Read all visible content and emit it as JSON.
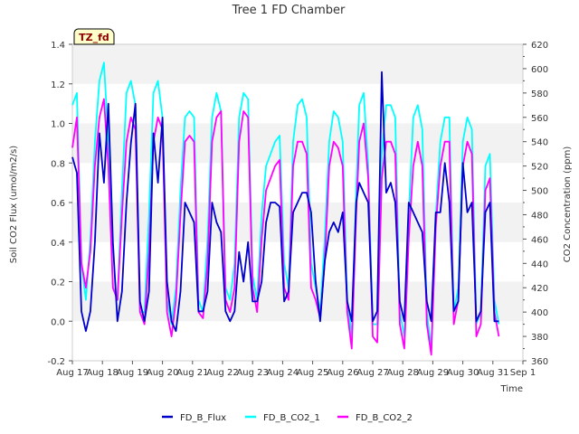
{
  "chart_data": {
    "type": "line",
    "title": "Tree 1 FD Chamber",
    "xlabel": "Time",
    "ylabel": "Soil CO2 Flux (umol/m2/s)",
    "y2label": "CO2 Concentration (ppm)",
    "badge": "TZ_fd",
    "grid": "horizontal bands",
    "legend_position": "bottom-center",
    "xlim": [
      17,
      32
    ],
    "ylim": [
      -0.2,
      1.4
    ],
    "y2lim": [
      360,
      620
    ],
    "x_ticks": [
      {
        "x": 17,
        "label": "Aug 17"
      },
      {
        "x": 18,
        "label": "Aug 18"
      },
      {
        "x": 19,
        "label": "Aug 19"
      },
      {
        "x": 20,
        "label": "Aug 20"
      },
      {
        "x": 21,
        "label": "Aug 21"
      },
      {
        "x": 22,
        "label": "Aug 22"
      },
      {
        "x": 23,
        "label": "Aug 23"
      },
      {
        "x": 24,
        "label": "Aug 24"
      },
      {
        "x": 25,
        "label": "Aug 25"
      },
      {
        "x": 26,
        "label": "Aug 26"
      },
      {
        "x": 27,
        "label": "Aug 27"
      },
      {
        "x": 28,
        "label": "Aug 28"
      },
      {
        "x": 29,
        "label": "Aug 29"
      },
      {
        "x": 30,
        "label": "Aug 30"
      },
      {
        "x": 31,
        "label": "Aug 31"
      },
      {
        "x": 32,
        "label": "Sep 1"
      }
    ],
    "y_ticks": [
      "-0.2",
      "0.0",
      "0.2",
      "0.4",
      "0.6",
      "0.8",
      "1.0",
      "1.2",
      "1.4"
    ],
    "y2_ticks": [
      "360",
      "380",
      "400",
      "420",
      "440",
      "460",
      "480",
      "500",
      "520",
      "540",
      "560",
      "580",
      "600",
      "620"
    ],
    "series": [
      {
        "name": "FD_B_Flux",
        "axis": "left",
        "color": "#0000cc",
        "x": [
          17.0,
          17.15,
          17.3,
          17.45,
          17.6,
          17.75,
          17.9,
          18.05,
          18.2,
          18.35,
          18.5,
          18.65,
          18.8,
          18.95,
          19.1,
          19.25,
          19.4,
          19.55,
          19.7,
          19.85,
          20.0,
          20.15,
          20.3,
          20.45,
          20.6,
          20.75,
          20.9,
          21.05,
          21.2,
          21.35,
          21.5,
          21.65,
          21.8,
          21.95,
          22.1,
          22.25,
          22.4,
          22.55,
          22.7,
          22.85,
          23.0,
          23.15,
          23.3,
          23.45,
          23.6,
          23.75,
          23.9,
          24.05,
          24.2,
          24.35,
          24.5,
          24.65,
          24.8,
          24.95,
          25.1,
          25.25,
          25.4,
          25.55,
          25.7,
          25.85,
          26.0,
          26.15,
          26.3,
          26.45,
          26.55,
          26.7,
          26.85,
          27.0,
          27.15,
          27.3,
          27.45,
          27.6,
          27.75,
          27.9,
          28.05,
          28.2,
          28.35,
          28.5,
          28.65,
          28.8,
          28.95,
          29.1,
          29.25,
          29.4,
          29.55,
          29.7,
          29.85,
          30.0,
          30.15,
          30.3,
          30.45,
          30.6,
          30.75,
          30.9,
          31.05,
          31.2
        ],
        "y": [
          0.83,
          0.75,
          0.05,
          -0.05,
          0.05,
          0.4,
          0.95,
          0.7,
          1.1,
          0.4,
          0.0,
          0.15,
          0.6,
          0.9,
          1.1,
          0.1,
          0.0,
          0.15,
          0.95,
          0.7,
          1.03,
          0.2,
          0.0,
          -0.05,
          0.15,
          0.6,
          0.55,
          0.5,
          0.05,
          0.05,
          0.15,
          0.6,
          0.5,
          0.45,
          0.05,
          0.0,
          0.05,
          0.35,
          0.2,
          0.4,
          0.1,
          0.1,
          0.2,
          0.5,
          0.6,
          0.6,
          0.58,
          0.1,
          0.15,
          0.55,
          0.6,
          0.65,
          0.65,
          0.55,
          0.2,
          0.0,
          0.3,
          0.45,
          0.5,
          0.45,
          0.55,
          0.1,
          0.0,
          0.6,
          0.7,
          0.65,
          0.6,
          0.0,
          0.05,
          1.26,
          0.65,
          0.7,
          0.6,
          0.1,
          0.0,
          0.6,
          0.55,
          0.5,
          0.45,
          0.1,
          0.0,
          0.55,
          0.55,
          0.8,
          0.6,
          0.05,
          0.1,
          0.8,
          0.55,
          0.6,
          0.0,
          0.05,
          0.55,
          0.6,
          0.0,
          0.0
        ]
      },
      {
        "name": "FD_B_CO2_1",
        "axis": "right",
        "color": "#00ffff",
        "x": [
          17.0,
          17.15,
          17.3,
          17.45,
          17.6,
          17.75,
          17.9,
          18.05,
          18.2,
          18.35,
          18.5,
          18.65,
          18.8,
          18.95,
          19.1,
          19.25,
          19.4,
          19.55,
          19.7,
          19.85,
          20.0,
          20.15,
          20.3,
          20.45,
          20.6,
          20.75,
          20.9,
          21.05,
          21.2,
          21.35,
          21.5,
          21.65,
          21.8,
          21.95,
          22.1,
          22.25,
          22.4,
          22.55,
          22.7,
          22.85,
          23.0,
          23.15,
          23.3,
          23.45,
          23.6,
          23.75,
          23.9,
          24.05,
          24.2,
          24.35,
          24.5,
          24.65,
          24.8,
          24.95,
          25.1,
          25.25,
          25.4,
          25.55,
          25.7,
          25.85,
          26.0,
          26.15,
          26.3,
          26.45,
          26.55,
          26.7,
          26.85,
          27.0,
          27.15,
          27.3,
          27.45,
          27.6,
          27.75,
          27.9,
          28.05,
          28.2,
          28.35,
          28.5,
          28.65,
          28.8,
          28.95,
          29.1,
          29.25,
          29.4,
          29.55,
          29.7,
          29.85,
          30.0,
          30.15,
          30.3,
          30.45,
          30.6,
          30.75,
          30.9,
          31.05,
          31.2
        ],
        "y": [
          570,
          580,
          440,
          410,
          460,
          540,
          590,
          605,
          540,
          420,
          410,
          500,
          580,
          590,
          570,
          400,
          400,
          480,
          580,
          590,
          560,
          410,
          390,
          420,
          500,
          560,
          565,
          560,
          410,
          400,
          460,
          560,
          580,
          565,
          420,
          410,
          440,
          560,
          580,
          575,
          430,
          410,
          480,
          520,
          530,
          540,
          545,
          440,
          420,
          540,
          570,
          575,
          560,
          440,
          420,
          400,
          460,
          540,
          565,
          560,
          540,
          410,
          380,
          500,
          570,
          580,
          520,
          390,
          390,
          530,
          570,
          570,
          560,
          400,
          380,
          480,
          560,
          570,
          550,
          400,
          370,
          480,
          540,
          560,
          560,
          400,
          420,
          540,
          560,
          550,
          390,
          400,
          520,
          530,
          410,
          390
        ]
      },
      {
        "name": "FD_B_CO2_2",
        "axis": "right",
        "color": "#ff00ff",
        "x": [
          17.0,
          17.15,
          17.3,
          17.45,
          17.6,
          17.75,
          17.9,
          18.05,
          18.2,
          18.35,
          18.5,
          18.65,
          18.8,
          18.95,
          19.1,
          19.25,
          19.4,
          19.55,
          19.7,
          19.85,
          20.0,
          20.15,
          20.3,
          20.45,
          20.6,
          20.75,
          20.9,
          21.05,
          21.2,
          21.35,
          21.5,
          21.65,
          21.8,
          21.95,
          22.1,
          22.25,
          22.4,
          22.55,
          22.7,
          22.85,
          23.0,
          23.15,
          23.3,
          23.45,
          23.6,
          23.75,
          23.9,
          24.05,
          24.2,
          24.35,
          24.5,
          24.65,
          24.8,
          24.95,
          25.1,
          25.25,
          25.4,
          25.55,
          25.7,
          25.85,
          26.0,
          26.15,
          26.3,
          26.45,
          26.55,
          26.7,
          26.85,
          27.0,
          27.15,
          27.3,
          27.45,
          27.6,
          27.75,
          27.9,
          28.05,
          28.2,
          28.35,
          28.5,
          28.65,
          28.8,
          28.95,
          29.1,
          29.25,
          29.4,
          29.55,
          29.7,
          29.85,
          30.0,
          30.15,
          30.3,
          30.45,
          30.6,
          30.75,
          30.9,
          31.05,
          31.2
        ],
        "y": [
          535,
          560,
          440,
          420,
          450,
          520,
          560,
          575,
          520,
          420,
          410,
          480,
          540,
          560,
          550,
          400,
          390,
          450,
          540,
          560,
          550,
          400,
          380,
          410,
          480,
          540,
          545,
          540,
          400,
          395,
          440,
          540,
          560,
          565,
          410,
          400,
          420,
          540,
          565,
          560,
          420,
          400,
          460,
          500,
          510,
          520,
          525,
          420,
          410,
          520,
          540,
          540,
          530,
          420,
          410,
          395,
          440,
          520,
          540,
          535,
          520,
          400,
          370,
          480,
          540,
          555,
          510,
          380,
          375,
          510,
          540,
          540,
          530,
          390,
          370,
          460,
          520,
          540,
          520,
          390,
          365,
          470,
          520,
          540,
          540,
          390,
          410,
          520,
          540,
          530,
          380,
          390,
          500,
          510,
          400,
          380
        ]
      }
    ]
  }
}
